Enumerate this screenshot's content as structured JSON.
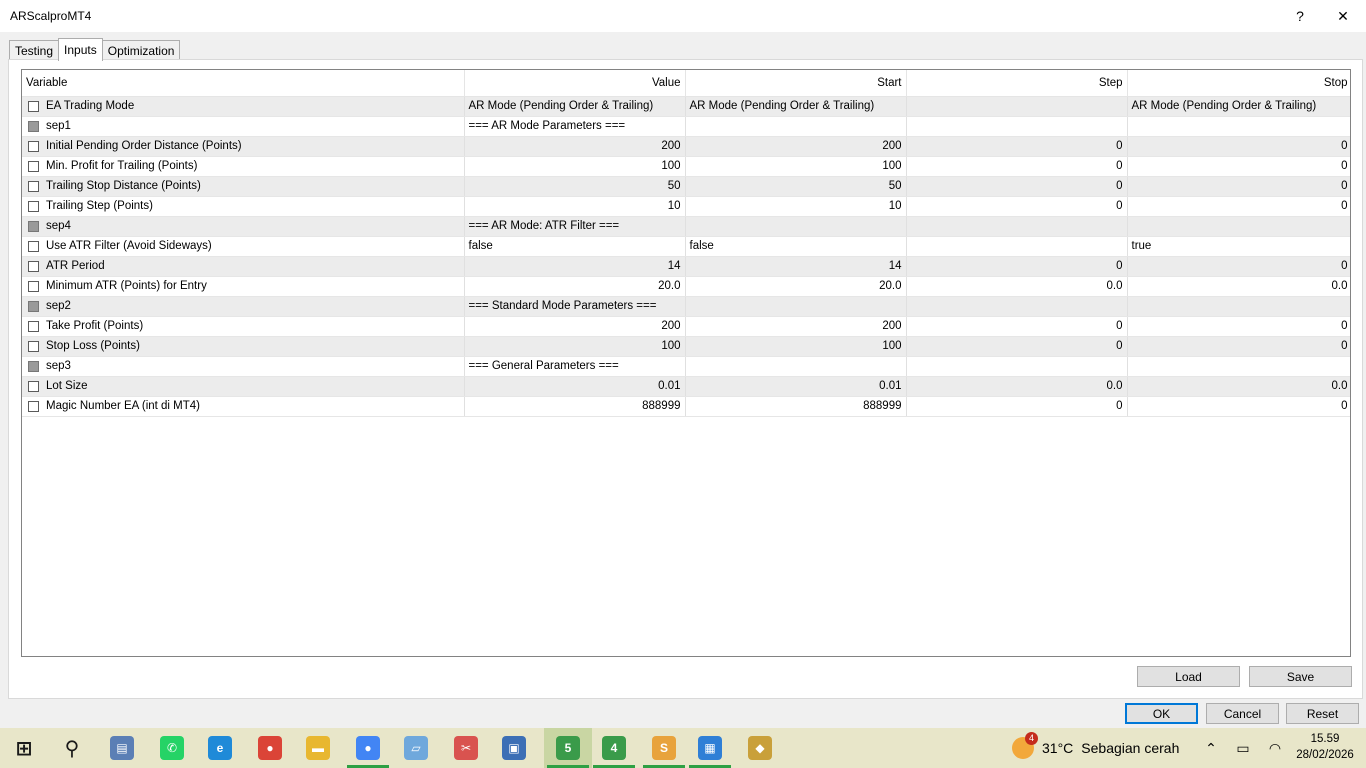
{
  "window": {
    "title": "ARScalproMT4",
    "help_label": "?",
    "close_label": "✕"
  },
  "tabs": [
    {
      "label": "Testing"
    },
    {
      "label": "Inputs"
    },
    {
      "label": "Optimization"
    }
  ],
  "table": {
    "headers": {
      "variable": "Variable",
      "value": "Value",
      "start": "Start",
      "step": "Step",
      "stop": "Stop"
    },
    "rows": [
      {
        "variable": "EA Trading Mode",
        "value": "AR Mode (Pending Order & Trailing)",
        "start": "AR Mode (Pending Order & Trailing)",
        "step": "",
        "stop": "AR Mode (Pending Order & Trailing)",
        "kind": "enum"
      },
      {
        "variable": "sep1",
        "value": "=== AR Mode Parameters ===",
        "start": "",
        "step": "",
        "stop": "",
        "kind": "sep"
      },
      {
        "variable": "Initial Pending Order Distance (Points)",
        "value": "200",
        "start": "200",
        "step": "0",
        "stop": "0",
        "kind": "num"
      },
      {
        "variable": "Min. Profit for Trailing (Points)",
        "value": "100",
        "start": "100",
        "step": "0",
        "stop": "0",
        "kind": "num"
      },
      {
        "variable": "Trailing Stop Distance (Points)",
        "value": "50",
        "start": "50",
        "step": "0",
        "stop": "0",
        "kind": "num"
      },
      {
        "variable": "Trailing Step (Points)",
        "value": "10",
        "start": "10",
        "step": "0",
        "stop": "0",
        "kind": "num"
      },
      {
        "variable": "sep4",
        "value": "=== AR Mode: ATR Filter ===",
        "start": "",
        "step": "",
        "stop": "",
        "kind": "sep"
      },
      {
        "variable": "Use ATR Filter (Avoid Sideways)",
        "value": "false",
        "start": "false",
        "step": "",
        "stop": "true",
        "kind": "enum"
      },
      {
        "variable": "ATR Period",
        "value": "14",
        "start": "14",
        "step": "0",
        "stop": "0",
        "kind": "num"
      },
      {
        "variable": "Minimum ATR (Points) for Entry",
        "value": "20.0",
        "start": "20.0",
        "step": "0.0",
        "stop": "0.0",
        "kind": "num"
      },
      {
        "variable": "sep2",
        "value": "=== Standard Mode Parameters ===",
        "start": "",
        "step": "",
        "stop": "",
        "kind": "sep"
      },
      {
        "variable": "Take Profit (Points)",
        "value": "200",
        "start": "200",
        "step": "0",
        "stop": "0",
        "kind": "num"
      },
      {
        "variable": "Stop Loss (Points)",
        "value": "100",
        "start": "100",
        "step": "0",
        "stop": "0",
        "kind": "num"
      },
      {
        "variable": "sep3",
        "value": "=== General Parameters ===",
        "start": "",
        "step": "",
        "stop": "",
        "kind": "sep"
      },
      {
        "variable": "Lot Size",
        "value": "0.01",
        "start": "0.01",
        "step": "0.0",
        "stop": "0.0",
        "kind": "num"
      },
      {
        "variable": "Magic Number EA (int di MT4)",
        "value": "888999",
        "start": "888999",
        "step": "0",
        "stop": "0",
        "kind": "num"
      }
    ]
  },
  "buttons": {
    "load": "Load",
    "save": "Save",
    "ok": "OK",
    "cancel": "Cancel",
    "reset": "Reset"
  },
  "taskbar": {
    "apps": [
      {
        "name": "start-icon",
        "color": "#1a1a1a",
        "glyph": "⊞"
      },
      {
        "name": "search-icon",
        "color": "#1a1a1a",
        "glyph": "⚲"
      },
      {
        "name": "file-explorer-icon",
        "color": "#5b7fb5",
        "glyph": "▤"
      },
      {
        "name": "whatsapp-icon",
        "color": "#25d366",
        "glyph": "✆"
      },
      {
        "name": "edge-icon",
        "color": "#1f8ad8",
        "glyph": "e"
      },
      {
        "name": "chrome-icon",
        "color": "#db4437",
        "glyph": "●"
      },
      {
        "name": "folder-icon",
        "color": "#e8b730",
        "glyph": "▬"
      },
      {
        "name": "chrome-profile-icon",
        "color": "#4285f4",
        "glyph": "●"
      },
      {
        "name": "notepad-icon",
        "color": "#6fa8dc",
        "glyph": "▱"
      },
      {
        "name": "snipping-tool-icon",
        "color": "#d9534f",
        "glyph": "✂"
      },
      {
        "name": "remote-desktop-icon",
        "color": "#3c6fb5",
        "glyph": "▣"
      },
      {
        "name": "metatrader5-icon",
        "color": "#3a9b4a",
        "glyph": "5"
      },
      {
        "name": "metatrader4-icon",
        "color": "#3a9b4a",
        "glyph": "4"
      },
      {
        "name": "sublime-icon",
        "color": "#e8a33c",
        "glyph": "S"
      },
      {
        "name": "chip-app-icon",
        "color": "#2f7fd6",
        "glyph": "▦"
      },
      {
        "name": "gem-app-icon",
        "color": "#c9a03a",
        "glyph": "◆"
      }
    ],
    "weather": {
      "badge": "4",
      "temp": "31°C",
      "desc": "Sebagian cerah"
    },
    "tray_icons": [
      {
        "name": "chevron-up-icon",
        "glyph": "⌃"
      },
      {
        "name": "battery-icon",
        "glyph": "▭"
      },
      {
        "name": "wifi-icon",
        "glyph": "◠"
      }
    ],
    "time": "15.59",
    "date": "28/02/2026"
  }
}
